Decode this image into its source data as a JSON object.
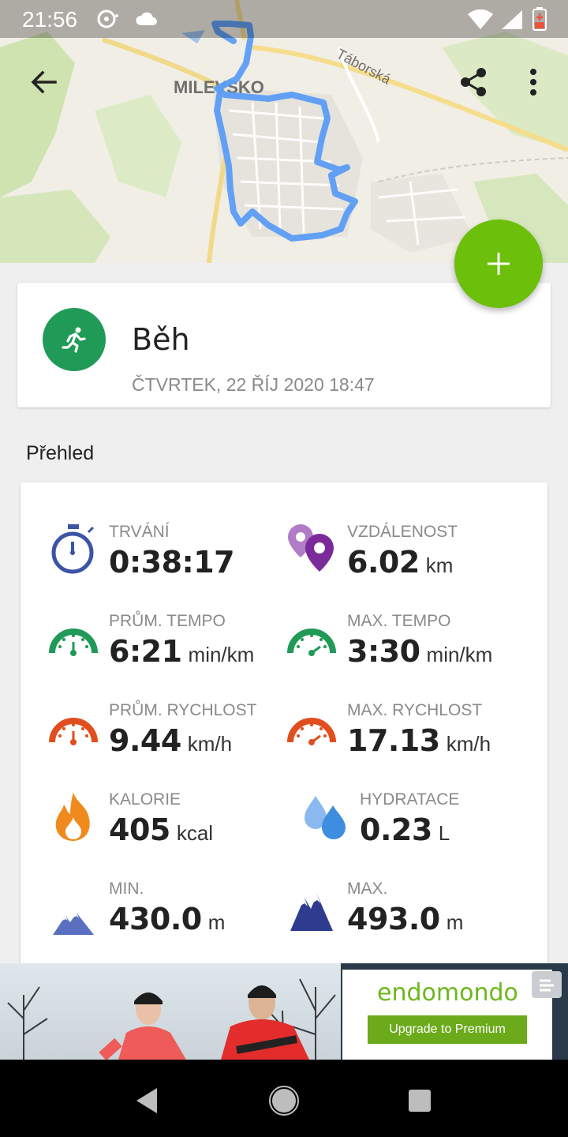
{
  "status_bar": {
    "time": "21:56"
  },
  "map": {
    "town_label": "MILEVSKO",
    "street_label": "Táborská"
  },
  "activity": {
    "title": "Běh",
    "date": "ČTVRTEK, 22 ŘÍJ 2020 18:47"
  },
  "overview": {
    "title": "Přehled",
    "stats": [
      {
        "label": "TRVÁNÍ",
        "value": "0:38:17",
        "unit": "",
        "icon": "stopwatch-icon",
        "color": "#3b54a4"
      },
      {
        "label": "VZDÁLENOST",
        "value": "6.02",
        "unit": "km",
        "icon": "distance-pin-icon",
        "color": "#7b2a9a"
      },
      {
        "label": "PRŮM. TEMPO",
        "value": "6:21",
        "unit": "min/km",
        "icon": "speedometer-icon",
        "color": "#1f9a57"
      },
      {
        "label": "MAX. TEMPO",
        "value": "3:30",
        "unit": "min/km",
        "icon": "speedometer-icon",
        "color": "#1f9a57"
      },
      {
        "label": "PRŮM. RYCHLOST",
        "value": "9.44",
        "unit": "km/h",
        "icon": "speedometer-icon",
        "color": "#e04e1e"
      },
      {
        "label": "MAX. RYCHLOST",
        "value": "17.13",
        "unit": "km/h",
        "icon": "speedometer-icon",
        "color": "#e04e1e"
      },
      {
        "label": "KALORIE",
        "value": "405",
        "unit": "kcal",
        "icon": "flame-icon",
        "color": "#f08a1c"
      },
      {
        "label": "HYDRATACE",
        "value": "0.23",
        "unit": "L",
        "icon": "water-drops-icon",
        "color": "#3d8de0"
      },
      {
        "label": "MIN.",
        "value": "430.0",
        "unit": "m",
        "icon": "mountains-icon",
        "color": "#5a6fbf"
      },
      {
        "label": "MAX.",
        "value": "493.0",
        "unit": "m",
        "icon": "mountains-icon",
        "color": "#2f3b8f"
      }
    ]
  },
  "ad": {
    "brand": "endomondo",
    "cta": "Upgrade to Premium"
  },
  "colors": {
    "fab": "#6cbf0a",
    "route": "#5b9cf5",
    "activity_badge": "#1f9a57"
  }
}
